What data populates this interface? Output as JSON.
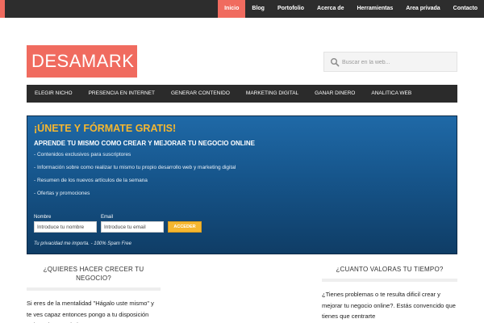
{
  "topnav": {
    "items": [
      "Inicio",
      "Blog",
      "Portofolio",
      "Acerca de",
      "Herramientas",
      "Area privada",
      "Contacto"
    ],
    "active_index": 0
  },
  "logo": {
    "text": "DESAMARK"
  },
  "search": {
    "placeholder": "Buscar en la web..."
  },
  "mainnav": {
    "items": [
      "ELEGIR NICHO",
      "PRESENCIA EN INTERNET",
      "GENERAR CONTENIDO",
      "MARKETING DIGITAL",
      "GANAR DINERO",
      "ANALITICA WEB"
    ]
  },
  "optin": {
    "headline": "¡ÚNETE Y FÓRMATE GRATIS!",
    "subheadline": "APRENDE TU MISMO COMO CREAR Y MEJORAR TU NEGOCIO ONLINE",
    "bullets": [
      "- Contenidos exclusivos para suscriptores",
      "- Información sobre como realizar tu mismo tu propio desarrollo web y marketing digital",
      "- Resumen de los nuevos artículos de la semana",
      "- Ofertas y promociones"
    ],
    "name_label": "Nombre",
    "name_placeholder": "Introduce tu nombre",
    "email_label": "Email",
    "email_placeholder": "Introduce tu email",
    "submit_label": "ACCEDER",
    "privacy": "Tu privacidad me importa. - 100% Spam Free"
  },
  "widgets": {
    "left": {
      "title": "¿QUIERES HACER CRECER TU NEGOCIO?",
      "text": "Si eres de la mentalidad \"Hágalo uste mismo\" y te ves capaz entonces pongo a tu disposición todos mis conocimientos en"
    },
    "right": {
      "title": "¿CUANTO VALORAS TU TIEMPO?",
      "text": "¿Tienes problemas o te resulta dificil crear y mejorar tu negocio online?. Estás convencido que tienes que centrarte"
    }
  },
  "colors": {
    "accent": "#f06b5f",
    "dark_bar": "#2d2d2d",
    "optin_blue": "#16558b",
    "optin_gold": "#f5b730"
  }
}
